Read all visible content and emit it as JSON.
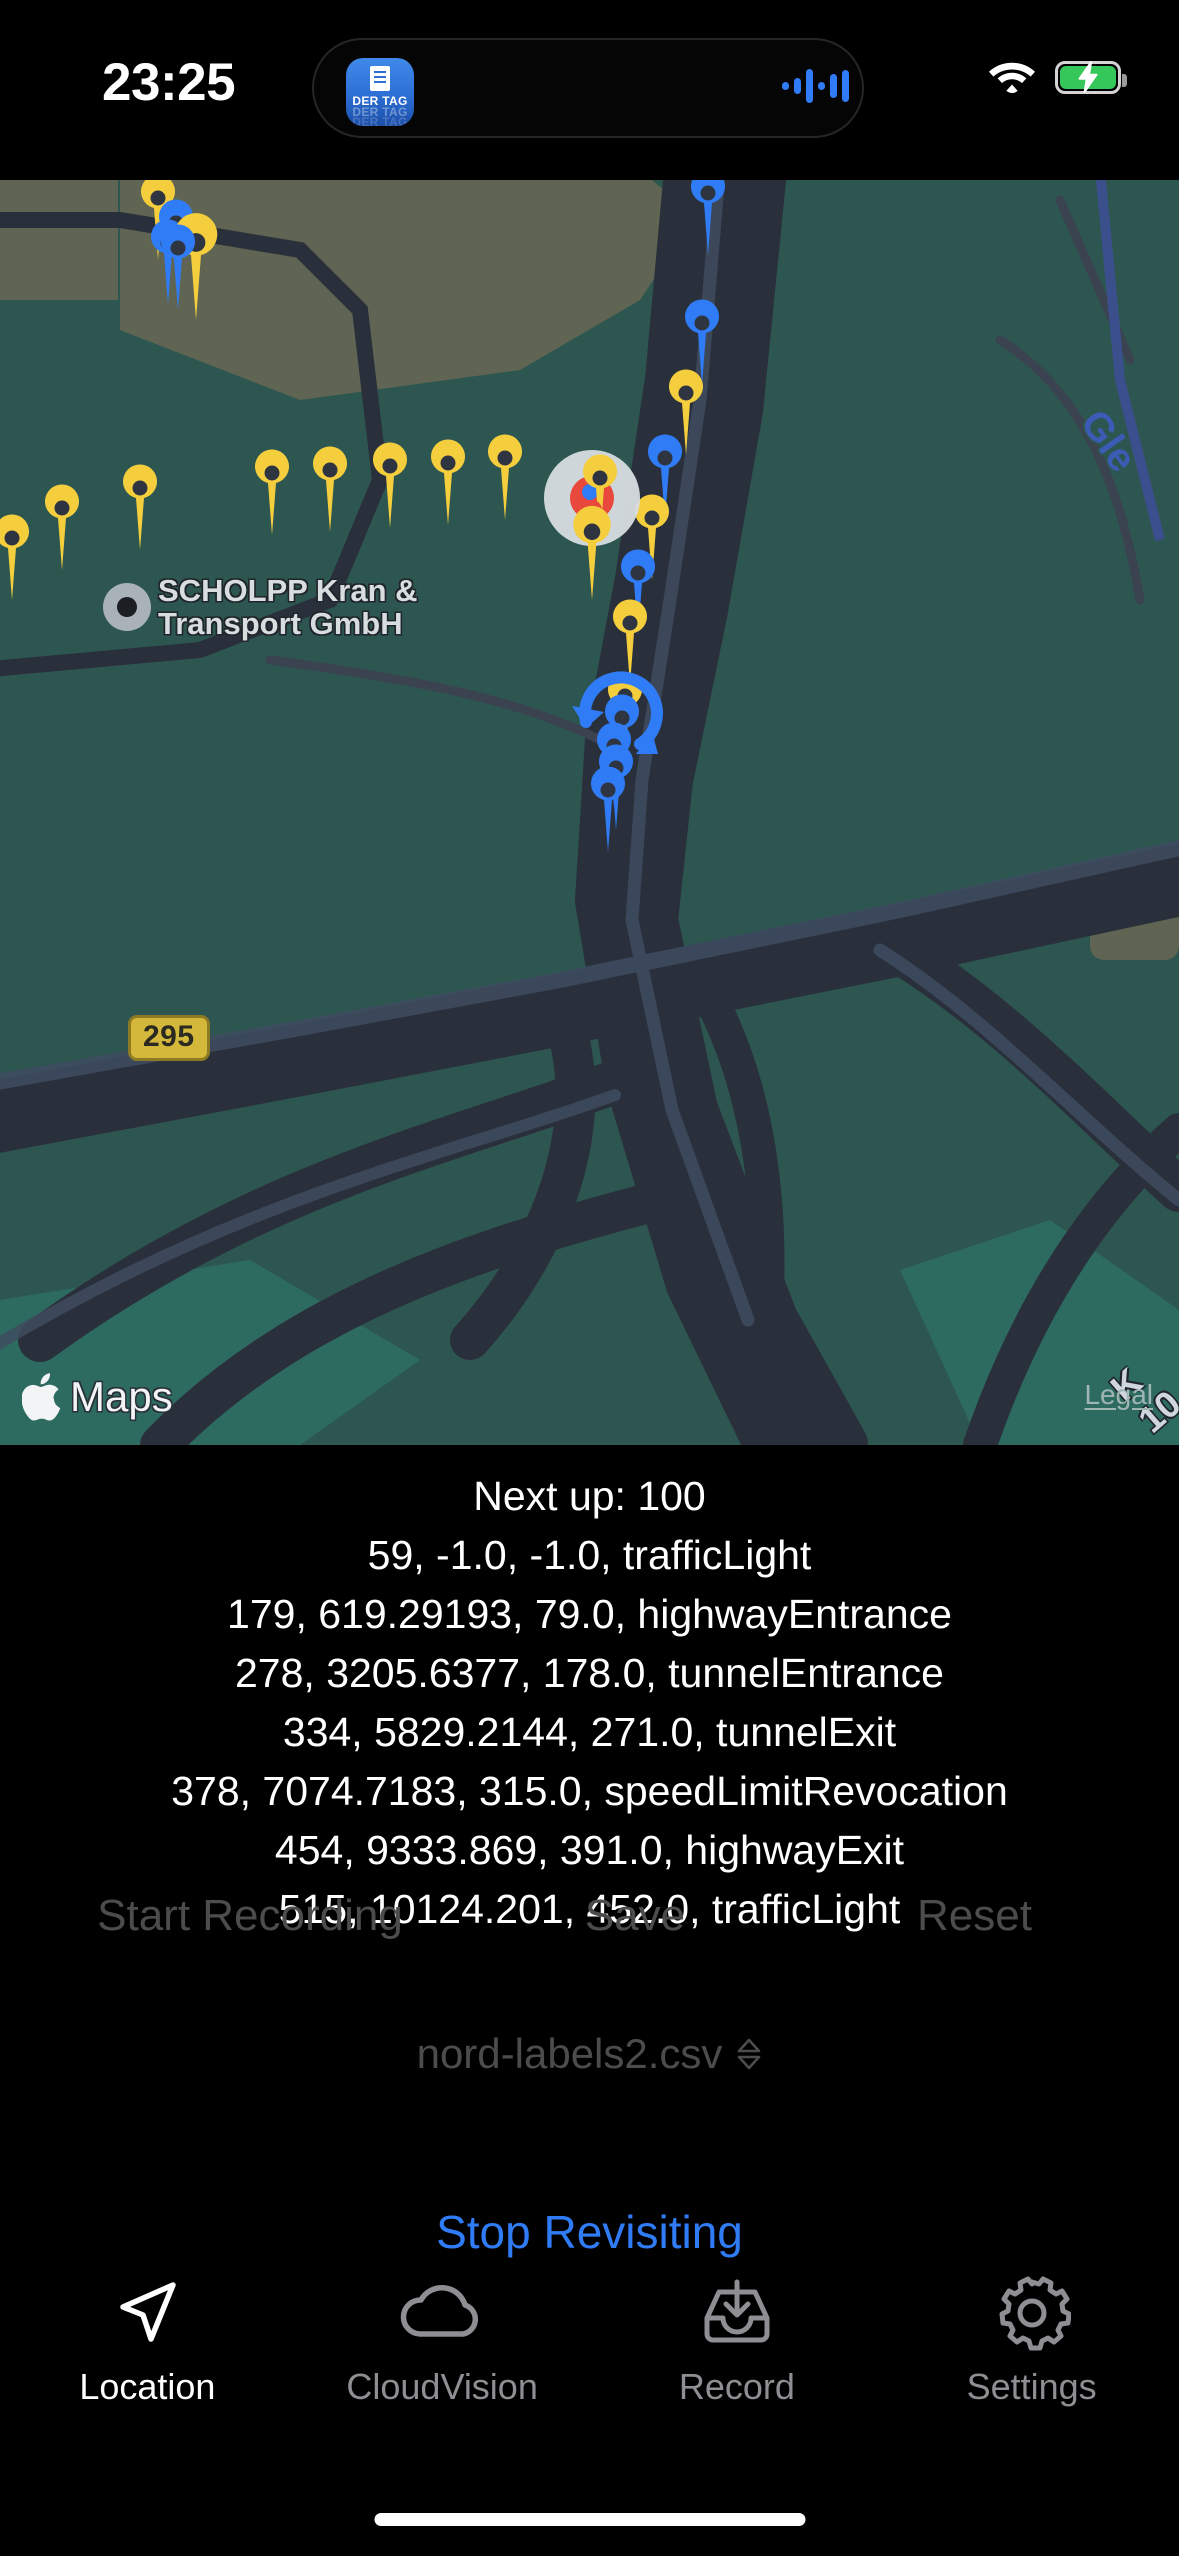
{
  "status_bar": {
    "time": "23:25",
    "dynamic_island_app": "DER TAG",
    "dynamic_island_app_ghost1": "DER TAG",
    "dynamic_island_app_ghost2": "DER TAG",
    "audio_icon": "audio-waveform-icon",
    "wifi_icon": "wifi-icon",
    "battery_icon": "battery-charging-icon",
    "battery_color": "#35c759"
  },
  "map": {
    "poi_label": "SCHOLPP Kran & Transport GmbH",
    "road_shield": "295",
    "road_label": "K 10",
    "water_label": "Gle",
    "attribution": "Maps",
    "legal_link": "Legal",
    "background_color": "#2d5651",
    "land_color": "#5f6552",
    "road_color": "#2a303b",
    "pin_yellow": "#f5ce3e",
    "pin_blue": "#2f7cf6",
    "pin_red": "#e8493c",
    "halo_color": "#d8dde0"
  },
  "panel": {
    "next_up": "Next up: 100",
    "rows": [
      "59, -1.0, -1.0, trafficLight",
      "179, 619.29193, 79.0, highwayEntrance",
      "278, 3205.6377, 178.0, tunnelEntrance",
      "334, 5829.2144, 271.0, tunnelExit",
      "378, 7074.7183, 315.0, speedLimitRevocation",
      "454, 9333.869, 391.0, highwayExit",
      "515, 10124.201, 452.0, trafficLight"
    ],
    "actions": {
      "start_recording": "Start Recording",
      "save": "Save",
      "reset": "Reset",
      "disabled_color": "#4c4c4e"
    },
    "file_picker": {
      "value": "nord-labels2.csv",
      "chevron_icon": "chevron-up-down-icon"
    },
    "revisit_button": "Stop Revisiting",
    "revisit_color": "#2f7cf6"
  },
  "tabbar": {
    "tabs": [
      {
        "label": "Location",
        "icon": "navigation-arrow-icon",
        "active": true
      },
      {
        "label": "CloudVision",
        "icon": "cloud-icon",
        "active": false
      },
      {
        "label": "Record",
        "icon": "tray-download-icon",
        "active": false
      },
      {
        "label": "Settings",
        "icon": "gear-icon",
        "active": false
      }
    ]
  }
}
